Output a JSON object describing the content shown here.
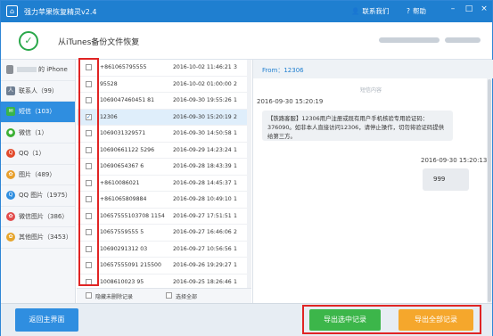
{
  "app": {
    "title": "强力苹果恢复精灵v2.4",
    "contact": "联系我们",
    "help": "帮助"
  },
  "header": {
    "title": "从iTunes备份文件恢复"
  },
  "sidebar": {
    "items": [
      {
        "label": "的 iPhone",
        "icon": "phone-icon",
        "color": "#8a8f96"
      },
      {
        "label": "联系人（99）",
        "icon": "contacts-icon",
        "color": "#6f7f93"
      },
      {
        "label": "短信（103）",
        "icon": "sms-icon",
        "color": "#39b54a"
      },
      {
        "label": "微信（1）",
        "icon": "wechat-icon",
        "color": "#3cb034"
      },
      {
        "label": "QQ（1）",
        "icon": "qq-icon",
        "color": "#e34a2b"
      },
      {
        "label": "图片（489）",
        "icon": "photos-icon",
        "color": "#e8a02e"
      },
      {
        "label": "QQ 图片（1975）",
        "icon": "qq-photos-icon",
        "color": "#2f8ee0"
      },
      {
        "label": "微信图片（386）",
        "icon": "wechat-photos-icon",
        "color": "#e24b4b"
      },
      {
        "label": "其他图片（3453）",
        "icon": "other-photos-icon",
        "color": "#e6a52c"
      }
    ]
  },
  "messages": {
    "rows": [
      {
        "number": "+861065795555",
        "date": "2016-10-02 11:46:21",
        "count": "3",
        "checked": false
      },
      {
        "number": "95528",
        "date": "2016-10-02 01:00:00",
        "count": "2",
        "checked": false
      },
      {
        "number": "1069047460451 81",
        "date": "2016-09-30 19:55:26",
        "count": "1",
        "checked": false
      },
      {
        "number": "12306",
        "date": "2016-09-30 15:20:19",
        "count": "2",
        "checked": true
      },
      {
        "number": "1069031329571",
        "date": "2016-09-30 14:50:58",
        "count": "1",
        "checked": false
      },
      {
        "number": "10690661122 5296",
        "date": "2016-09-29 14:23:24",
        "count": "1",
        "checked": false
      },
      {
        "number": "10690654367 6",
        "date": "2016-09-28 18:43:39",
        "count": "1",
        "checked": false
      },
      {
        "number": "+8610086021",
        "date": "2016-09-28 14:45:37",
        "count": "1",
        "checked": false
      },
      {
        "number": "+861065809884",
        "date": "2016-09-28 10:49:10",
        "count": "1",
        "checked": false
      },
      {
        "number": "10657555103708 1154",
        "date": "2016-09-27 17:51:51",
        "count": "1",
        "checked": false
      },
      {
        "number": "10657559555 5",
        "date": "2016-09-27 16:46:06",
        "count": "2",
        "checked": false
      },
      {
        "number": "10690291312 03",
        "date": "2016-09-27 10:56:56",
        "count": "1",
        "checked": false
      },
      {
        "number": "10657555091 215500",
        "date": "2016-09-26 19:29:27",
        "count": "1",
        "checked": false
      },
      {
        "number": "1008610023 95",
        "date": "2016-09-25 18:26:46",
        "count": "1",
        "checked": false
      }
    ],
    "hide_unrecovered": "隐藏未删除记录",
    "select_all": "选择全部"
  },
  "detail": {
    "from": "From：12306",
    "section": "短信内容",
    "time1": "2016-09-30 15:20:19",
    "bubble1": "【铁路客服】12306用户注册或既有用户手机核验专用验证码：376090。如非本人直接访问12306，请停止操作，切勿将验证码提供给第三方。",
    "time2": "2016-09-30 15:20:13",
    "bubble2": "999"
  },
  "footer": {
    "back": "返回主界面",
    "export_selected": "导出选中记录",
    "export_all": "导出全部记录"
  },
  "colors": {
    "title_bar": "#1f7fd0",
    "active": "#2f8ee0",
    "green": "#3cb64a",
    "orange": "#f5a72c",
    "highlight": "#e02424"
  }
}
